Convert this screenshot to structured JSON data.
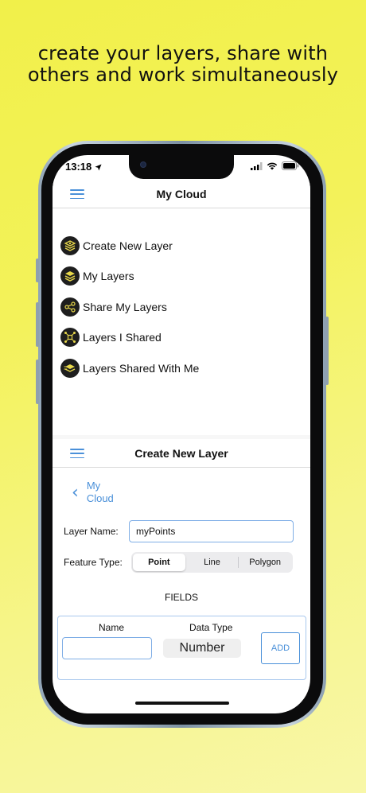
{
  "headline": {
    "line1": "create your layers, share with",
    "line2": "others and work simultaneously"
  },
  "status_bar": {
    "time": "13:18",
    "icons": [
      "location-arrow-icon",
      "cellular-signal-icon",
      "wifi-icon",
      "battery-icon"
    ]
  },
  "cloud_screen": {
    "title": "My Cloud",
    "menu_items": [
      {
        "label": "Create New Layer",
        "icon": "create-layer-icon"
      },
      {
        "label": "My Layers",
        "icon": "layers-stack-icon"
      },
      {
        "label": "Share My Layers",
        "icon": "share-icon"
      },
      {
        "label": "Layers I Shared",
        "icon": "shared-network-icon"
      },
      {
        "label": "Layers Shared With Me",
        "icon": "incoming-layers-icon"
      }
    ]
  },
  "create_screen": {
    "title": "Create New Layer",
    "back_label_line1": "My",
    "back_label_line2": "Cloud",
    "layer_name_label": "Layer Name:",
    "layer_name_value": "myPoints",
    "feature_type_label": "Feature Type:",
    "feature_types": [
      "Point",
      "Line",
      "Polygon"
    ],
    "selected_feature_type": "Point",
    "fields_title": "FIELDS",
    "name_column": "Name",
    "data_type_column": "Data Type",
    "name_value": "",
    "data_type_value": "Number",
    "add_button": "ADD"
  },
  "colors": {
    "accent": "#4a90d9",
    "background_yellow": "#f1f04a",
    "icon_yellow": "#e8d84a",
    "icon_bg": "#1e1e1e"
  }
}
